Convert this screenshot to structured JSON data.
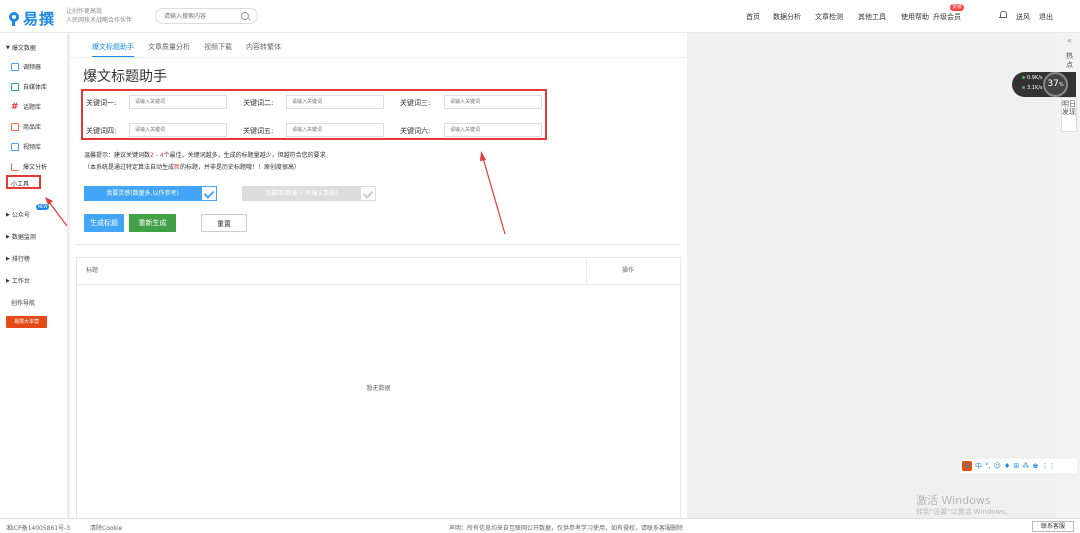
{
  "header": {
    "logo_text": "易撰",
    "slogan_line1": "让创作更高效",
    "slogan_line2": "人民网技术战略合作伙伴",
    "search_placeholder": "请输入搜索内容",
    "nav": [
      "首页",
      "数据分析",
      "文章检测",
      "其他工具",
      "使用帮助",
      "升级会员"
    ],
    "vip_badge": "安装",
    "user": "送风",
    "logout": "退出"
  },
  "sidebar": {
    "section": "爆文数据",
    "items": [
      {
        "label": "调频器",
        "icon": "grid-icon",
        "color": "#42a5f5"
      },
      {
        "label": "自媒体库",
        "icon": "doc-icon",
        "color": "#26a69a"
      },
      {
        "label": "话题库",
        "icon": "hash-icon",
        "color": "#e53935"
      },
      {
        "label": "商品库",
        "icon": "box-icon",
        "color": "#ff7043"
      },
      {
        "label": "视频库",
        "icon": "video-icon",
        "color": "#42a5f5"
      },
      {
        "label": "爆文分析",
        "icon": "chart-icon",
        "color": "#ff7043"
      }
    ],
    "tools": "小工具",
    "groups": [
      "公众号",
      "数据监测",
      "排行榜",
      "工作台"
    ],
    "new_badge": "NEW",
    "guide": "创作导航",
    "fortune": "易撰大本营"
  },
  "tabs": [
    "爆文标题助手",
    "文章质量分析",
    "视频下载",
    "内容转繁体"
  ],
  "page_title": "爆文标题助手",
  "keywords": {
    "labels": [
      "关键词一:",
      "关键词二:",
      "关键词三:",
      "关键词四:",
      "关键词五:",
      "关键词六:"
    ],
    "placeholder": "请输入关键词"
  },
  "tips": {
    "line1_a": "温馨提示：建议关键词数",
    "line1_red": "2 - 4",
    "line1_b": "个最佳，关键词越多，生成的标题量越少，但越符合您的要求",
    "line2_a": "（本系统是通过特定算法自动生成",
    "line2_red": "新",
    "line2_b": "的标题，并非是历史标题哦！！原创度很高）"
  },
  "options": {
    "flexible": "我要灵感(数量多,以作参考)",
    "precise": "我要精(数量少,有爆文数据)"
  },
  "actions": {
    "generate": "生成标题",
    "regenerate": "重新生成",
    "reset": "重置"
  },
  "table": {
    "col_title": "标题",
    "col_action": "操作",
    "empty": "暂无数据"
  },
  "right": {
    "hot": "热点",
    "tab2": "明日发现",
    "speed_up": "0.9",
    "speed_down": "3.1",
    "speed_unit": "K/s",
    "percent": "37",
    "percent_sign": "%"
  },
  "ime": {
    "logo": "S",
    "items": [
      "中",
      "°,",
      "☺",
      "♦",
      "⊞",
      "⁂",
      "♚",
      "⋮⋮"
    ]
  },
  "watermark": {
    "line1": "激活 Windows",
    "line2": "转到\"设置\"以激活 Windows。"
  },
  "footer": {
    "icp": "湘ICP备14005861号-3",
    "clear_cookie": "清除Cookie",
    "notice": "声明：所有信息均来自互联网公开数据，仅供参考学习使用，如有侵权，请联系客服删除",
    "contact": "联系客服"
  }
}
